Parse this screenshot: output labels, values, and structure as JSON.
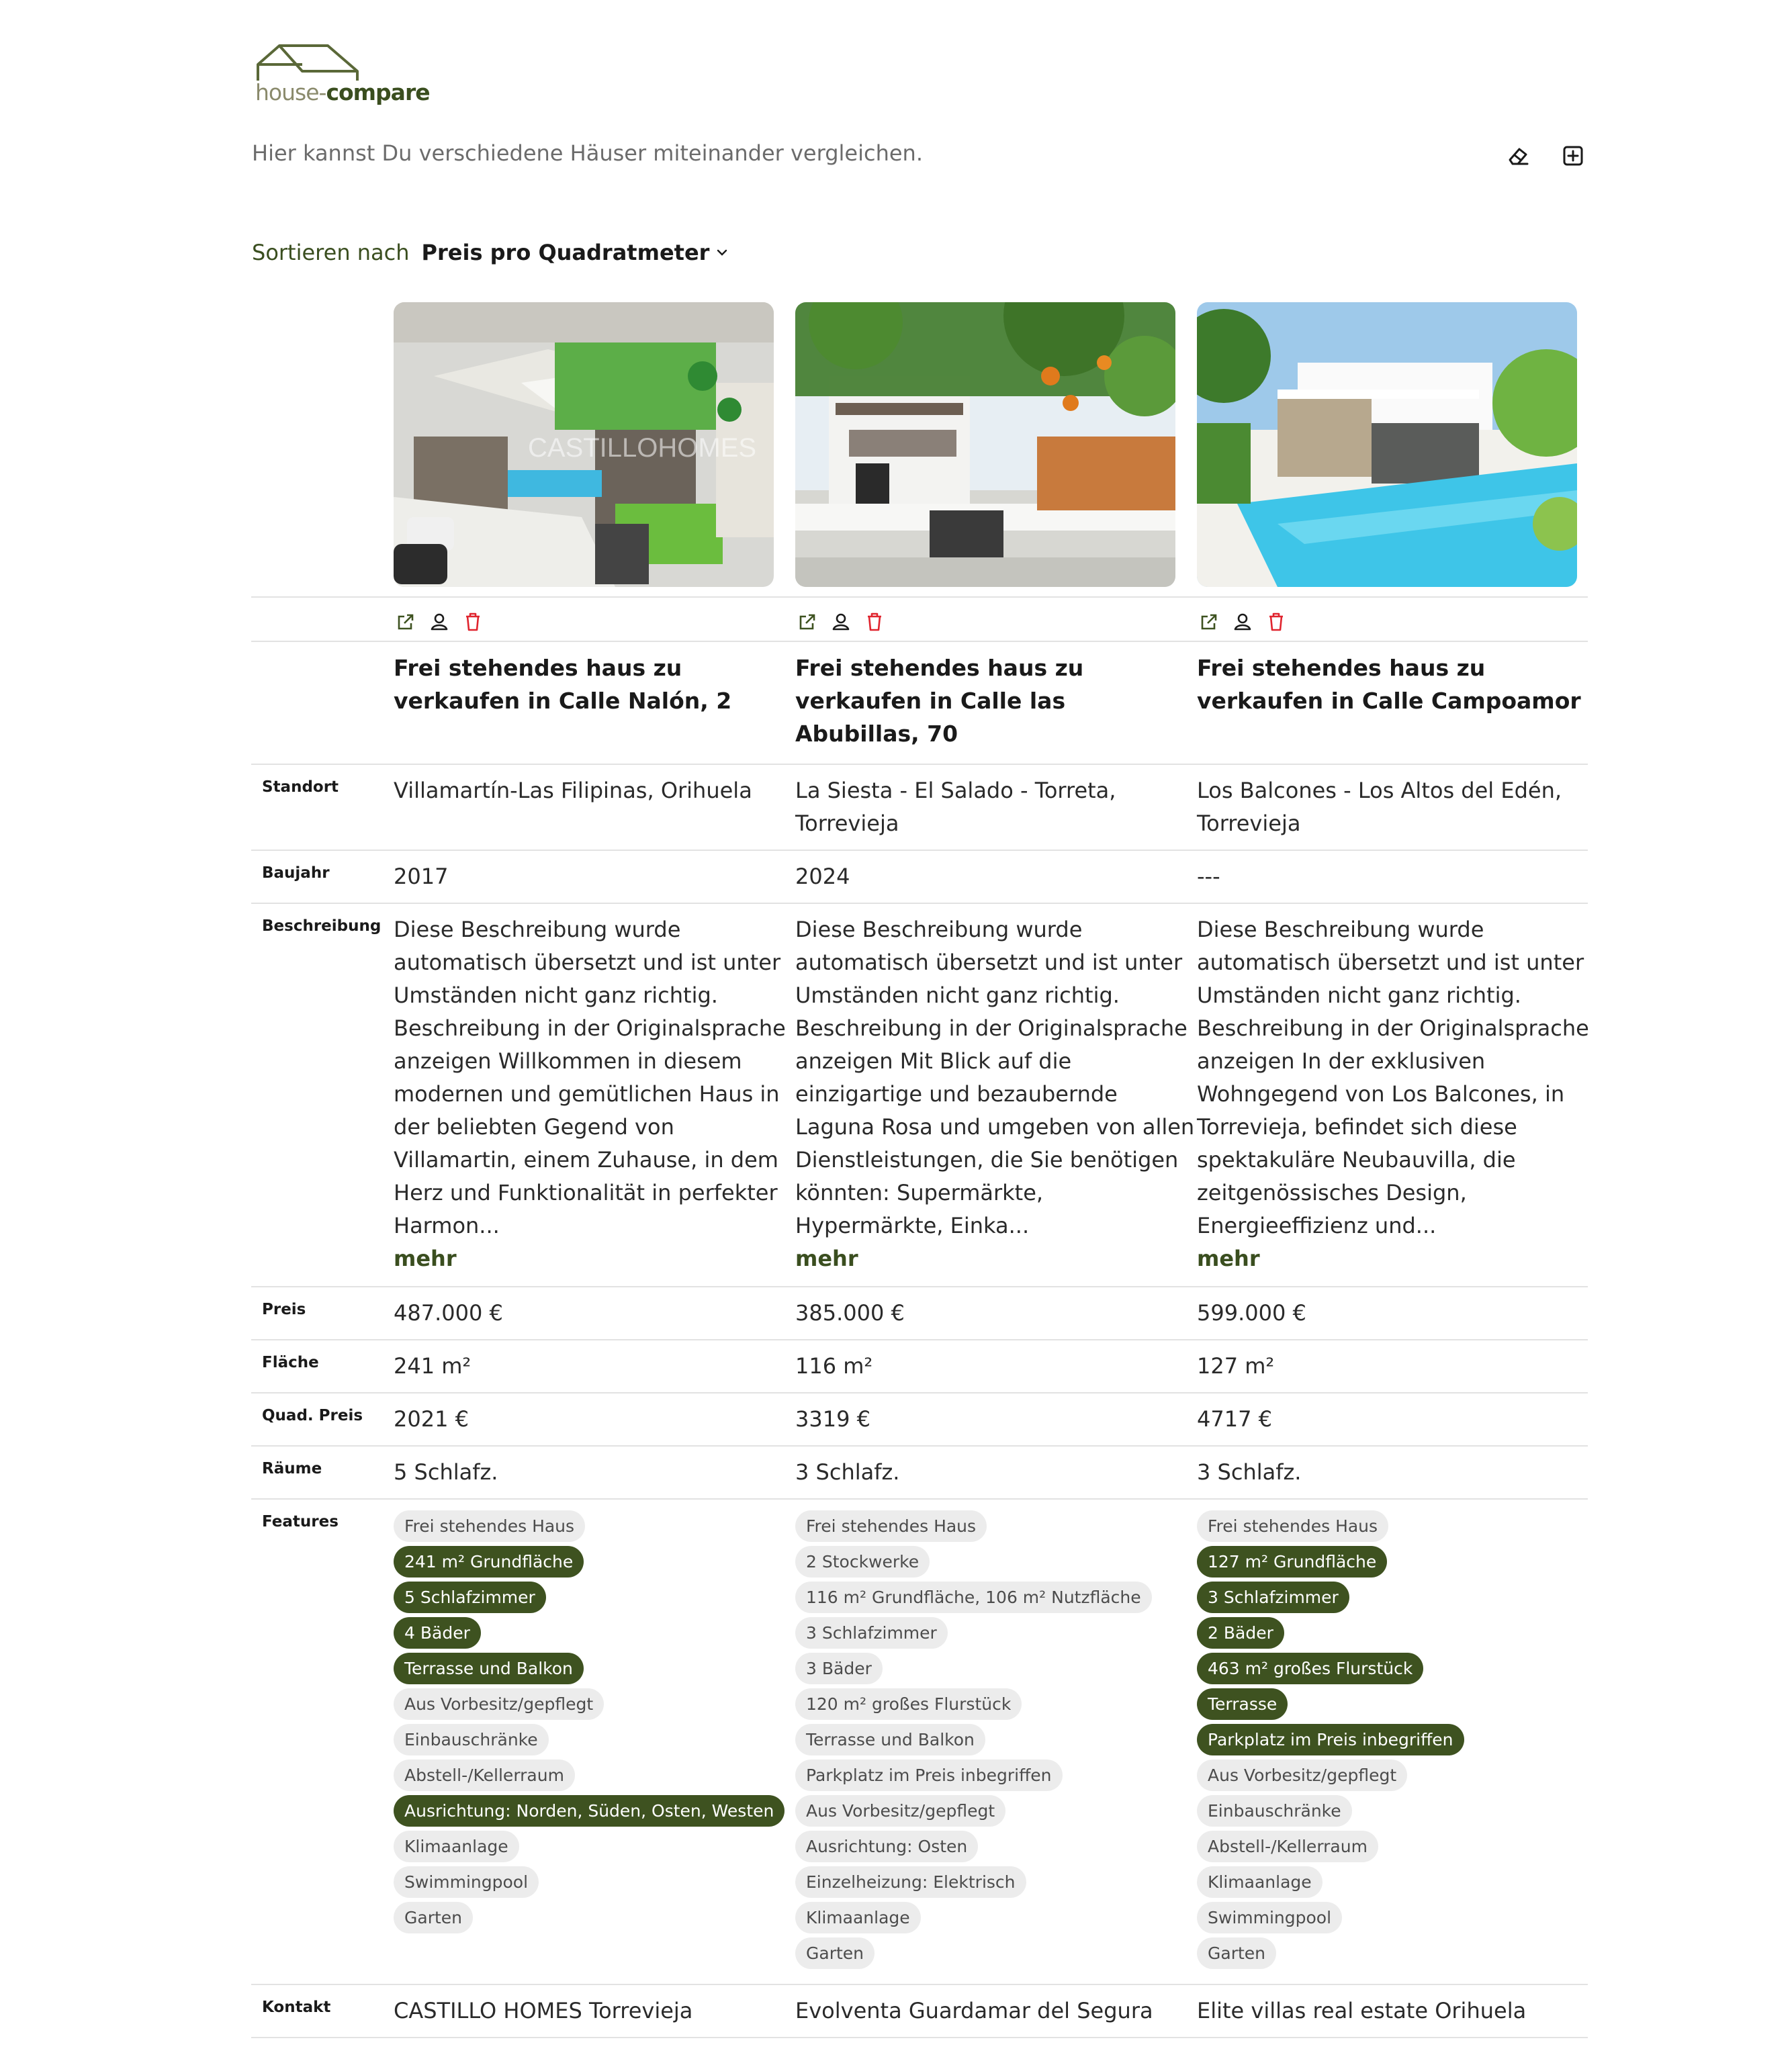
{
  "header": {
    "logo_text_light": "house-",
    "logo_text_bold": "compare",
    "intro": "Hier kannst Du verschiedene Häuser miteinander vergleichen.",
    "clear_icon": "eraser-icon",
    "add_icon": "add-square-icon"
  },
  "sort": {
    "label": "Sortieren nach",
    "value": "Preis pro Quadratmeter"
  },
  "rows": {
    "standort": "Standort",
    "baujahr": "Baujahr",
    "beschreibung": "Beschreibung",
    "preis": "Preis",
    "flaeche": "Fläche",
    "quad_preis": "Quad. Preis",
    "raeume": "Räume",
    "features": "Features",
    "kontakt": "Kontakt"
  },
  "more_label": "mehr",
  "houses": [
    {
      "title": "Frei stehendes haus zu verkaufen in Calle Nalón, 2",
      "location": "Villamartín-Las Filipinas, Orihuela",
      "year": "2017",
      "description": "Diese Beschreibung wurde automatisch übersetzt und ist unter Umständen nicht ganz richtig. Beschreibung in der Originalsprache anzeigen Willkommen in diesem modernen und gemütlichen Haus in der beliebten Gegend von Villamartin, einem Zuhause, in dem Herz und Funktionalität in perfekter Harmon...",
      "price": "487.000 €",
      "area": "241 m²",
      "sqm_price": "2021 €",
      "rooms": "5 Schlafz.",
      "contact": "CASTILLO HOMES Torrevieja",
      "watermark": "CASTILLOHOMES",
      "features": [
        {
          "label": "Frei stehendes Haus",
          "hl": false
        },
        {
          "label": "241 m² Grundfläche",
          "hl": true
        },
        {
          "label": "5 Schlafzimmer",
          "hl": true
        },
        {
          "label": "4 Bäder",
          "hl": true
        },
        {
          "label": "Terrasse und Balkon",
          "hl": true
        },
        {
          "label": "Aus Vorbesitz/gepflegt",
          "hl": false
        },
        {
          "label": "Einbauschränke",
          "hl": false
        },
        {
          "label": "Abstell-/Kellerraum",
          "hl": false
        },
        {
          "label": "Ausrichtung: Norden, Süden, Osten, Westen",
          "hl": true
        },
        {
          "label": "Klimaanlage",
          "hl": false
        },
        {
          "label": "Swimmingpool",
          "hl": false
        },
        {
          "label": "Garten",
          "hl": false
        }
      ]
    },
    {
      "title": "Frei stehendes haus zu verkaufen in Calle las Abubillas, 70",
      "location": "La Siesta - El Salado - Torreta, Torrevieja",
      "year": "2024",
      "description": "Diese Beschreibung wurde automatisch übersetzt und ist unter Umständen nicht ganz richtig. Beschreibung in der Originalsprache anzeigen Mit Blick auf die einzigartige und bezaubernde Laguna Rosa und umgeben von allen Dienstleistungen, die Sie benötigen könnten: Supermärkte, Hypermärkte, Einka...",
      "price": "385.000 €",
      "area": "116 m²",
      "sqm_price": "3319 €",
      "rooms": "3 Schlafz.",
      "contact": "Evolventa Guardamar del Segura",
      "features": [
        {
          "label": "Frei stehendes Haus",
          "hl": false
        },
        {
          "label": "2 Stockwerke",
          "hl": false
        },
        {
          "label": "116 m² Grundfläche, 106 m² Nutzfläche",
          "hl": false
        },
        {
          "label": "3 Schlafzimmer",
          "hl": false
        },
        {
          "label": "3 Bäder",
          "hl": false
        },
        {
          "label": "120 m² großes Flurstück",
          "hl": false
        },
        {
          "label": "Terrasse und Balkon",
          "hl": false
        },
        {
          "label": "Parkplatz im Preis inbegriffen",
          "hl": false
        },
        {
          "label": "Aus Vorbesitz/gepflegt",
          "hl": false
        },
        {
          "label": "Ausrichtung: Osten",
          "hl": false
        },
        {
          "label": "Einzelheizung: Elektrisch",
          "hl": false
        },
        {
          "label": "Klimaanlage",
          "hl": false
        },
        {
          "label": "Garten",
          "hl": false
        }
      ]
    },
    {
      "title": "Frei stehendes haus zu verkaufen in Calle Campoamor",
      "location": "Los Balcones - Los Altos del Edén, Torrevieja",
      "year": "---",
      "description": "Diese Beschreibung wurde automatisch übersetzt und ist unter Umständen nicht ganz richtig. Beschreibung in der Originalsprache anzeigen In der exklusiven Wohngegend von Los Balcones, in Torrevieja, befindet sich diese spektakuläre Neubauvilla, die zeitgenössisches Design, Energieeffizienz und...",
      "price": "599.000 €",
      "area": "127 m²",
      "sqm_price": "4717 €",
      "rooms": "3 Schlafz.",
      "contact": "Elite villas real estate Orihuela",
      "features": [
        {
          "label": "Frei stehendes Haus",
          "hl": false
        },
        {
          "label": "127 m² Grundfläche",
          "hl": true
        },
        {
          "label": "3 Schlafzimmer",
          "hl": true
        },
        {
          "label": "2 Bäder",
          "hl": true
        },
        {
          "label": "463 m² großes Flurstück",
          "hl": true
        },
        {
          "label": "Terrasse",
          "hl": true
        },
        {
          "label": "Parkplatz im Preis inbegriffen",
          "hl": true
        },
        {
          "label": "Aus Vorbesitz/gepflegt",
          "hl": false
        },
        {
          "label": "Einbauschränke",
          "hl": false
        },
        {
          "label": "Abstell-/Kellerraum",
          "hl": false
        },
        {
          "label": "Klimaanlage",
          "hl": false
        },
        {
          "label": "Swimmingpool",
          "hl": false
        },
        {
          "label": "Garten",
          "hl": false
        }
      ]
    }
  ],
  "colors": {
    "brand": "#3e5220",
    "tag_bg": "#ececec",
    "delete": "#e0242e"
  }
}
